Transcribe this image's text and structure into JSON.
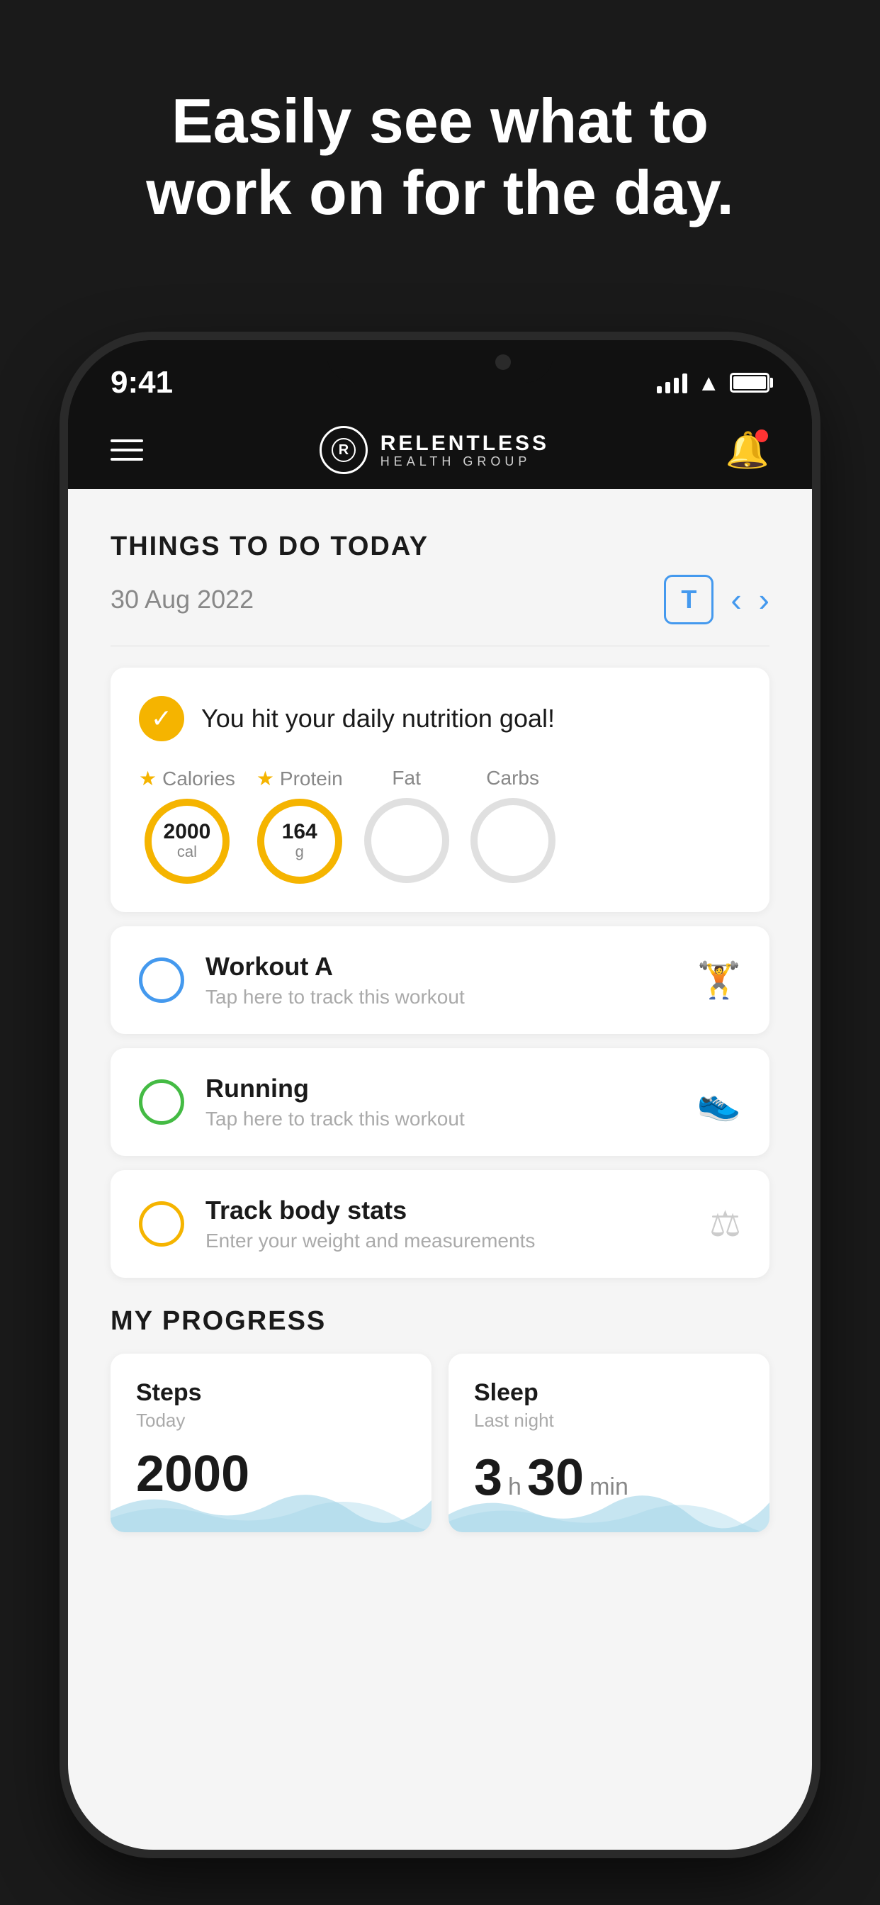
{
  "hero": {
    "line1": "Easily see what to",
    "line2": "work on for the day."
  },
  "status_bar": {
    "time": "9:41"
  },
  "app_header": {
    "logo_letter": "R",
    "brand_name": "RELENTLESS",
    "brand_sub": "HEALTH GROUP"
  },
  "main": {
    "section_title": "THINGS TO DO TODAY",
    "date": "30 Aug 2022",
    "today_button": "T",
    "nutrition": {
      "goal_text": "You hit your daily nutrition goal!",
      "macros": [
        {
          "label": "Calories",
          "starred": true,
          "value": "2000",
          "unit": "cal",
          "active": true
        },
        {
          "label": "Protein",
          "starred": true,
          "value": "164",
          "unit": "g",
          "active": true
        },
        {
          "label": "Fat",
          "starred": false,
          "value": "",
          "unit": "",
          "active": false
        },
        {
          "label": "Carbs",
          "starred": false,
          "value": "",
          "unit": "",
          "active": false
        }
      ]
    },
    "tasks": [
      {
        "name": "Workout A",
        "desc": "Tap here to track this workout",
        "circle_style": "blue",
        "icon": "🏋"
      },
      {
        "name": "Running",
        "desc": "Tap here to track this workout",
        "circle_style": "green",
        "icon": "👟"
      },
      {
        "name": "Track body stats",
        "desc": "Enter your weight and measurements",
        "circle_style": "yellow",
        "icon": "⚖"
      }
    ],
    "progress": {
      "section_title": "MY PROGRESS",
      "cards": [
        {
          "title": "Steps",
          "subtitle": "Today",
          "value": "2000",
          "value_display": "2000",
          "type": "steps"
        },
        {
          "title": "Sleep",
          "subtitle": "Last night",
          "hours": "3",
          "hours_unit": "h",
          "minutes": "30",
          "minutes_unit": "min",
          "type": "sleep"
        }
      ]
    }
  },
  "colors": {
    "brand": "#f5b400",
    "blue": "#4499ee",
    "green": "#44bb44",
    "background": "#1a1a1a",
    "wave": "#a0d4e8"
  }
}
